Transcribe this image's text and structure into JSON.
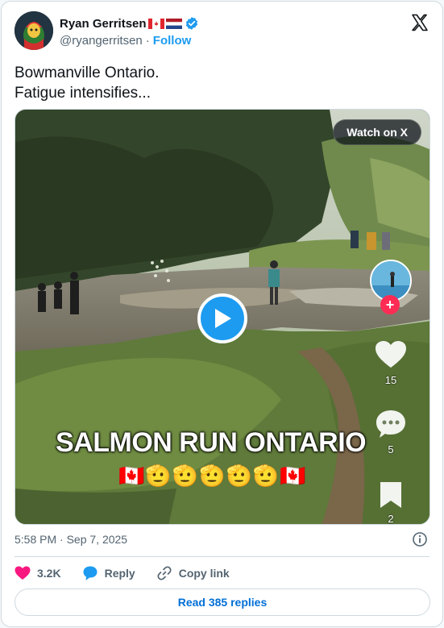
{
  "author": {
    "name": "Ryan Gerritsen",
    "flags": [
      "canada-flag",
      "netherlands-flag"
    ],
    "handle": "@ryangerritsen",
    "separator": "·",
    "follow_label": "Follow"
  },
  "tweet": {
    "line1": "Bowmanville Ontario.",
    "line2": "Fatigue intensifies..."
  },
  "media": {
    "watch_label": "Watch on X",
    "overlay_title": "SALMON RUN ONTARIO",
    "overlay_emojis": "🇨🇦🫡🫡🫡🫡🫡🇨🇦",
    "side_like_count": "15",
    "side_comment_count": "5",
    "side_bookmark_count": "2"
  },
  "footer": {
    "timestamp": "5:58 PM · Sep 7, 2025",
    "likes": "3.2K",
    "reply_label": "Reply",
    "copy_label": "Copy link",
    "read_replies_label": "Read 385 replies"
  },
  "colors": {
    "accent": "#1d9bf0",
    "like_pink": "#f91880",
    "text_secondary": "#536471",
    "border": "#cfd9de"
  }
}
